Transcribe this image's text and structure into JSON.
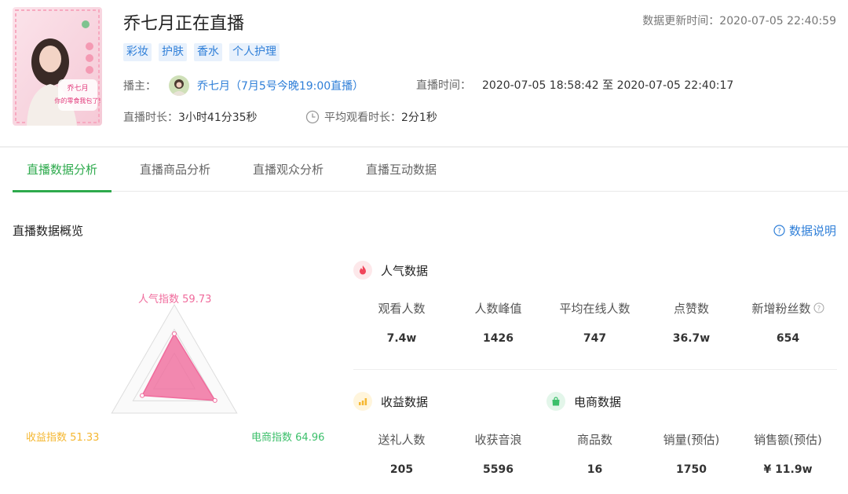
{
  "header": {
    "title": "乔七月正在直播",
    "update_time": "数据更新时间：2020-07-05 22:40:59",
    "cover_text": "乔七月",
    "cover_caption": "你的零食我包了!",
    "tags": [
      "彩妆",
      "护肤",
      "香水",
      "个人护理"
    ],
    "anchor_label": "播主：",
    "anchor_name": "乔七月（7月5号今晚19:00直播）",
    "live_time_label": "直播时间：",
    "live_time_value": "2020-07-05 18:58:42 至 2020-07-05 22:40:17",
    "duration_label": "直播时长：",
    "duration_value": "3小时41分35秒",
    "avg_watch_label": "平均观看时长：",
    "avg_watch_value": "2分1秒"
  },
  "tabs": [
    "直播数据分析",
    "直播商品分析",
    "直播观众分析",
    "直播互动数据"
  ],
  "active_tab": 0,
  "overview": {
    "title": "直播数据概览",
    "help_link": "数据说明"
  },
  "radar": {
    "popularity": {
      "label": "人气指数",
      "value": 59.73,
      "text": "59.73"
    },
    "commerce": {
      "label": "电商指数",
      "value": 64.96,
      "text": "64.96"
    },
    "revenue": {
      "label": "收益指数",
      "value": 51.33,
      "text": "51.33"
    }
  },
  "popularity_data": {
    "title": "人气数据",
    "metrics": [
      {
        "label": "观看人数",
        "value": "7.4w"
      },
      {
        "label": "人数峰值",
        "value": "1426"
      },
      {
        "label": "平均在线人数",
        "value": "747"
      },
      {
        "label": "点赞数",
        "value": "36.7w"
      },
      {
        "label": "新增粉丝数",
        "value": "654"
      }
    ]
  },
  "revenue_data": {
    "title": "收益数据",
    "metrics": [
      {
        "label": "送礼人数",
        "value": "205"
      },
      {
        "label": "收获音浪",
        "value": "5596"
      }
    ]
  },
  "commerce_data": {
    "title": "电商数据",
    "metrics": [
      {
        "label": "商品数",
        "value": "16"
      },
      {
        "label": "销量(预估)",
        "value": "1750"
      },
      {
        "label": "销售额(预估)",
        "value": "¥ 11.9w"
      }
    ]
  },
  "colors": {
    "accent_green": "#2eaa4d",
    "link_blue": "#2f7fd8",
    "radar_pink": "#f06b9c",
    "revenue_yellow": "#f5b731",
    "commerce_green": "#3bbf6a"
  }
}
